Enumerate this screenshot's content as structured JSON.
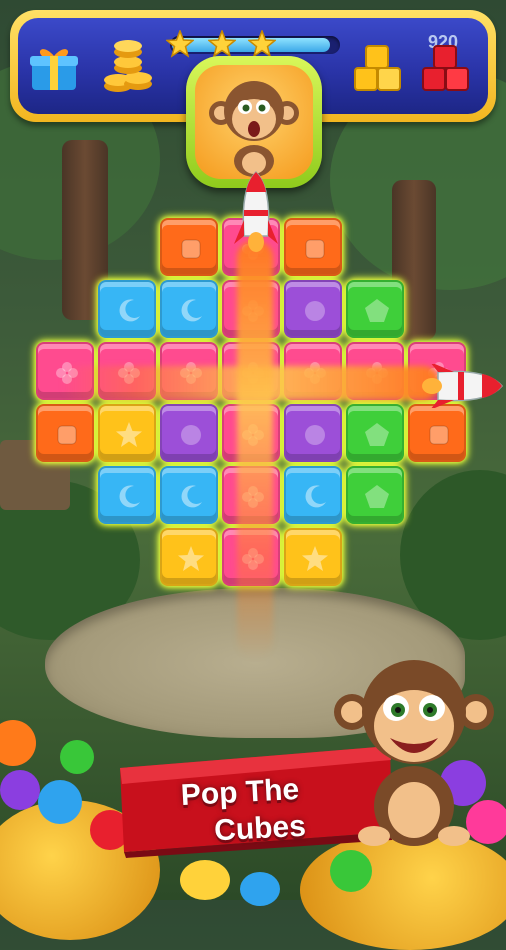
{
  "hud": {
    "score": "920",
    "progress_fraction": 0.95,
    "stars_earned": 3,
    "icons": [
      "gift-icon",
      "coin-stack-icon",
      "star-icon",
      "yellow-cube-goal-icon",
      "red-cube-goal-icon"
    ]
  },
  "level_character": "monkey-portrait",
  "board": {
    "colors": {
      "orange": "#ff6a1a",
      "blue": "#37b6f5",
      "purple": "#9c4fd8",
      "pink": "#ff4b8f",
      "green": "#3fcf3a",
      "yellow": "#ffc21a"
    },
    "rows": [
      [
        "",
        "",
        "orange",
        "pink",
        "orange",
        "",
        "",
        ""
      ],
      [
        "",
        "blue",
        "blue",
        "pink",
        "purple",
        "green",
        "",
        ""
      ],
      [
        "pink",
        "pink",
        "pink",
        "pink",
        "pink",
        "pink",
        "pink",
        ""
      ],
      [
        "orange",
        "yellow",
        "purple",
        "pink",
        "purple",
        "green",
        "orange",
        ""
      ],
      [
        "",
        "blue",
        "blue",
        "pink",
        "blue",
        "green",
        "",
        ""
      ],
      [
        "",
        "",
        "yellow",
        "pink",
        "yellow",
        "",
        "",
        ""
      ]
    ],
    "boosters": [
      "vertical-rocket",
      "horizontal-rocket"
    ]
  },
  "banner": {
    "line1": "Pop The",
    "line2": "Cubes"
  }
}
